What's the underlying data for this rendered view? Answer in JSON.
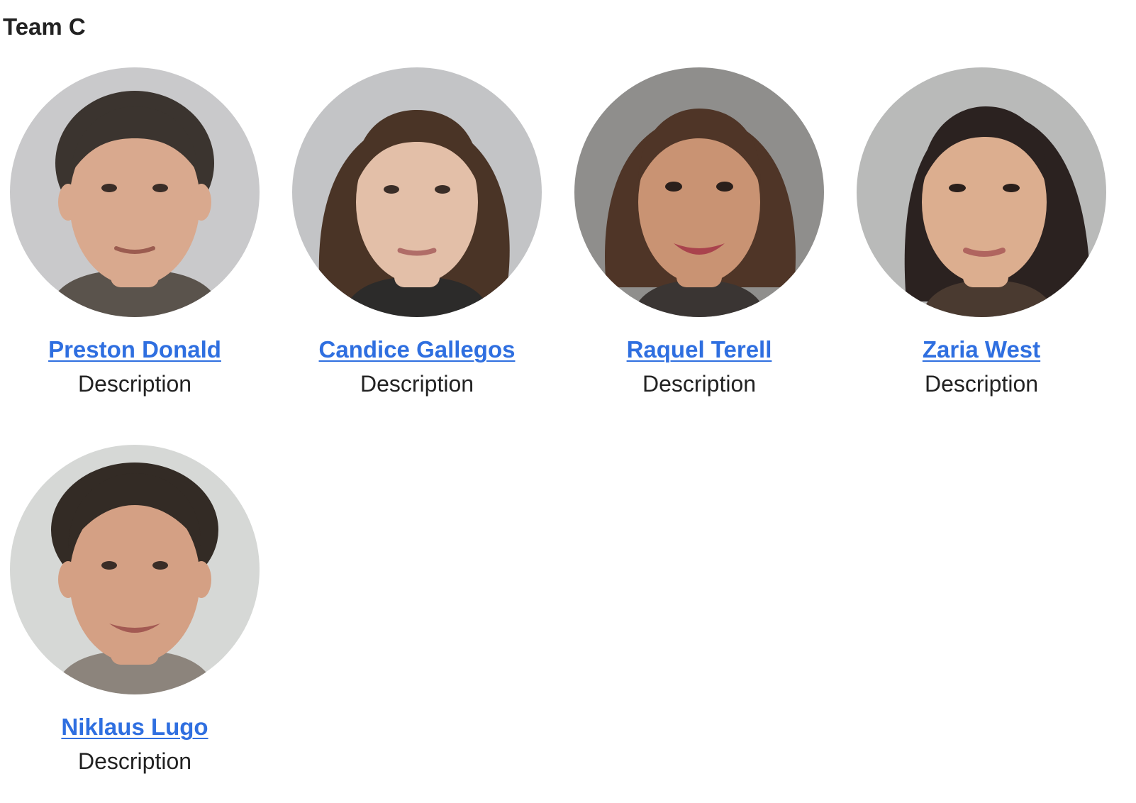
{
  "team": {
    "title": "Team C"
  },
  "members": [
    {
      "name": "Preston Donald",
      "description": "Description",
      "photo": {
        "bg": "#c9c9cb",
        "skin": "#d9a98e",
        "hair": "#3b342f",
        "shirt": "#5a534c"
      }
    },
    {
      "name": "Candice Gallegos",
      "description": "Description",
      "photo": {
        "bg": "#c3c4c6",
        "skin": "#e3bfa8",
        "hair": "#4a3426",
        "shirt": "#2c2b2a"
      }
    },
    {
      "name": "Raquel Terell",
      "description": "Description",
      "photo": {
        "bg": "#8f8e8c",
        "skin": "#c99373",
        "hair": "#4f3527",
        "shirt": "#3a3533"
      }
    },
    {
      "name": "Zaria West",
      "description": "Description",
      "photo": {
        "bg": "#b9bab9",
        "skin": "#dcae8f",
        "hair": "#2b2220",
        "shirt": "#4a3a30"
      }
    },
    {
      "name": "Niklaus Lugo",
      "description": "Description",
      "photo": {
        "bg": "#d6d8d6",
        "skin": "#d4a084",
        "hair": "#332b25",
        "shirt": "#8c847c"
      }
    }
  ]
}
